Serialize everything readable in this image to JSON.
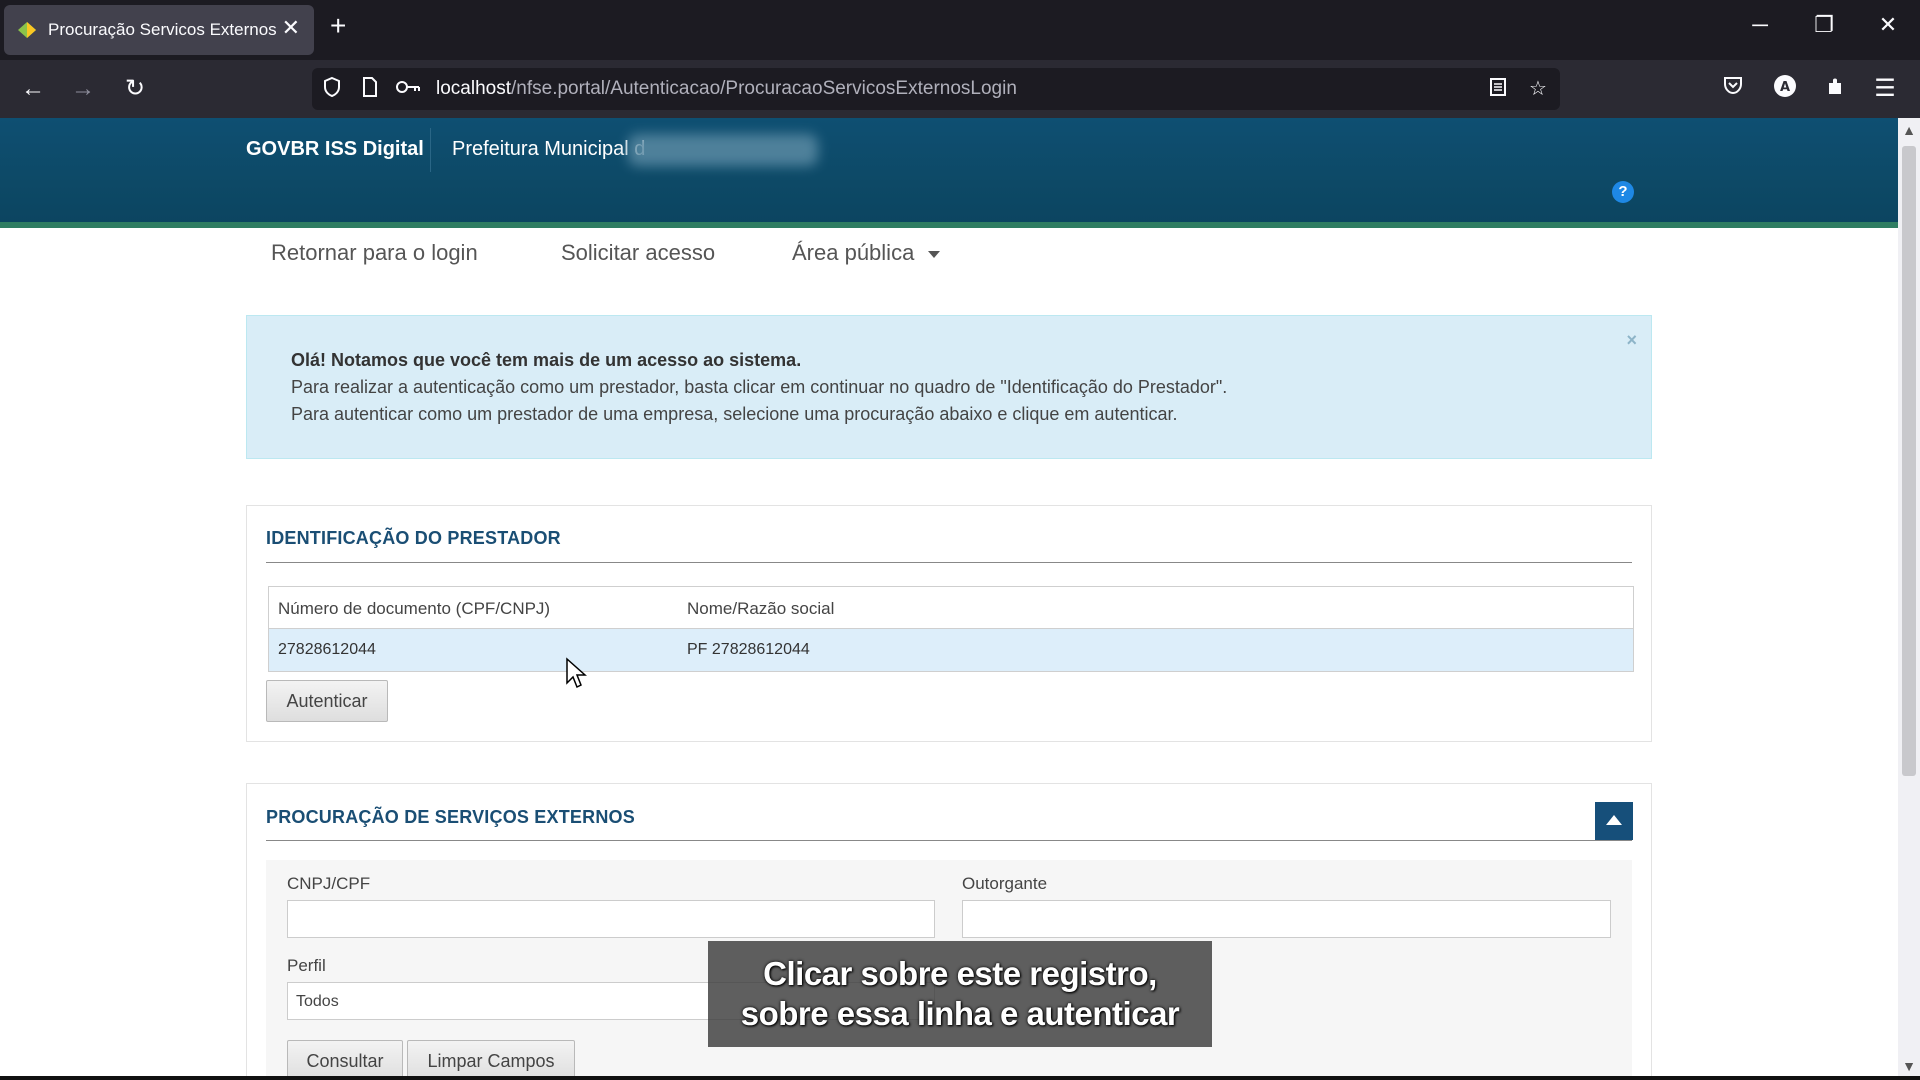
{
  "browser": {
    "tab_title": "Procuração Servicos Externos",
    "tab_close": "✕",
    "new_tab": "+",
    "url_host": "localhost",
    "url_path": "/nfse.portal/Autenticacao/ProcuracaoServicosExternosLogin",
    "window": {
      "minimize": "─",
      "restore": "❐",
      "close": "✕"
    }
  },
  "header": {
    "brand": "GOVBR ISS Digital",
    "municipality": "Prefeitura Municipal d",
    "help": "?"
  },
  "menu": {
    "return_login": "Retornar para o login",
    "request_access": "Solicitar acesso",
    "public_area": "Área pública"
  },
  "alert": {
    "line1": "Olá! Notamos que você tem mais de um acesso ao sistema.",
    "line2": "Para realizar a autenticação como um prestador, basta clicar em continuar no quadro de \"Identificação do Prestador\".",
    "line3": "Para autenticar como um prestador de uma empresa, selecione uma procuração abaixo e clique em autenticar.",
    "close": "×"
  },
  "identificacao": {
    "title": "IDENTIFICAÇÃO DO PRESTADOR",
    "columns": [
      "Número de documento (CPF/CNPJ)",
      "Nome/Razão social"
    ],
    "rows": [
      {
        "documento": "27828612044",
        "nome": "PF 27828612044"
      }
    ],
    "authenticate_button": "Autenticar"
  },
  "procuracao": {
    "title": "PROCURAÇÃO DE SERVIÇOS EXTERNOS",
    "cnpj_label": "CNPJ/CPF",
    "cnpj_value": "",
    "outorgante_label": "Outorgante",
    "outorgante_value": "",
    "perfil_label": "Perfil",
    "perfil_selected": "Todos",
    "consultar_button": "Consultar",
    "limpar_button": "Limpar Campos"
  },
  "subtitle": {
    "line1": "Clicar sobre este registro,",
    "line2": "sobre essa linha e autenticar"
  },
  "colors": {
    "banner": "#0e4f72",
    "accent_stripe": "#2f7d62",
    "title_blue": "#1a4e74",
    "alert_bg": "#d9edf7",
    "selected_row": "#ddeefa"
  }
}
